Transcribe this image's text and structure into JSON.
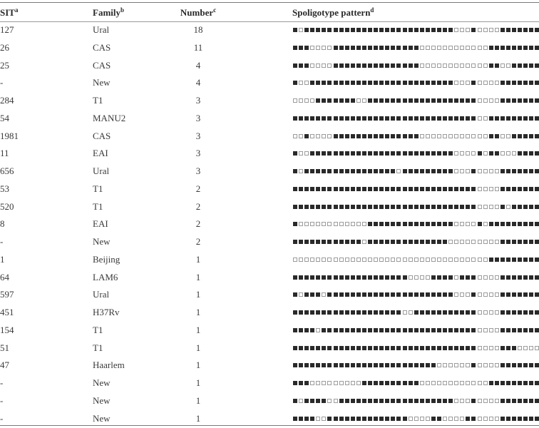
{
  "table": {
    "headers": {
      "sit": {
        "label": "SIT",
        "note": "a"
      },
      "family": {
        "label": "Family",
        "note": "b"
      },
      "number": {
        "label": "Number",
        "note": "c"
      },
      "pattern": {
        "label": "Spoligotype pattern",
        "note": "d"
      }
    },
    "legend": {
      "present": "■",
      "absent": "□"
    },
    "rows": [
      {
        "sit": "127",
        "family": "Ural",
        "number": "18",
        "pattern": "1011111111111111111111111111000100001111111"
      },
      {
        "sit": "26",
        "family": "CAS",
        "number": "11",
        "pattern": "1110000111111111111111000000000000111111111"
      },
      {
        "sit": "25",
        "family": "CAS",
        "number": "4",
        "pattern": "1110000111111111111111000000000000110011111"
      },
      {
        "sit": "-",
        "family": "New",
        "number": "4",
        "pattern": "1001111111111111111111111111000100001111111"
      },
      {
        "sit": "284",
        "family": "T1",
        "number": "3",
        "pattern": "0000111111100111111111111111111100001111111"
      },
      {
        "sit": "54",
        "family": "MANU2",
        "number": "3",
        "pattern": "1111111111111111111111111111111100111111111"
      },
      {
        "sit": "1981",
        "family": "CAS",
        "number": "3",
        "pattern": "0010000111111111111111000000000000110011111"
      },
      {
        "sit": "11",
        "family": "EAI",
        "number": "3",
        "pattern": "1001111111111111111111111111000010110001111"
      },
      {
        "sit": "656",
        "family": "Ural",
        "number": "3",
        "pattern": "1011111111111111110111111111000100001111111"
      },
      {
        "sit": "53",
        "family": "T1",
        "number": "2",
        "pattern": "1111111111111111111111111111111100001111111"
      },
      {
        "sit": "520",
        "family": "T1",
        "number": "2",
        "pattern": "1111111111111111111111111111111100001011111"
      },
      {
        "sit": "8",
        "family": "EAI",
        "number": "2",
        "pattern": "1000000000000111111111111111000010111111111"
      },
      {
        "sit": "-",
        "family": "New",
        "number": "2",
        "pattern": "1111111111110111111111111110000000001111111"
      },
      {
        "sit": "1",
        "family": "Beijing",
        "number": "1",
        "pattern": "0000000000000000000000000000000000111111111"
      },
      {
        "sit": "64",
        "family": "LAM6",
        "number": "1",
        "pattern": "1111111111111111111100001111011100001111111"
      },
      {
        "sit": "597",
        "family": "Ural",
        "number": "1",
        "pattern": "1011101111111111111111111111000100001111111"
      },
      {
        "sit": "451",
        "family": "H37Rv",
        "number": "1",
        "pattern": "1111111111111111111001111111111100001111111"
      },
      {
        "sit": "154",
        "family": "T1",
        "number": "1",
        "pattern": "1111011111111111111111111111111100001111111"
      },
      {
        "sit": "51",
        "family": "T1",
        "number": "1",
        "pattern": "1111111111111111111111111111111100001110000"
      },
      {
        "sit": "47",
        "family": "Haarlem",
        "number": "1",
        "pattern": "1111111111111111111111111000000100001111111"
      },
      {
        "sit": "-",
        "family": "New",
        "number": "1",
        "pattern": "1110000000001111111111000000000000111111111"
      },
      {
        "sit": "-",
        "family": "New",
        "number": "1",
        "pattern": "1011110011111111111111111111000100001111111"
      },
      {
        "sit": "-",
        "family": "New",
        "number": "1",
        "pattern": "1111001111111111111100001100001100001111111"
      }
    ]
  }
}
